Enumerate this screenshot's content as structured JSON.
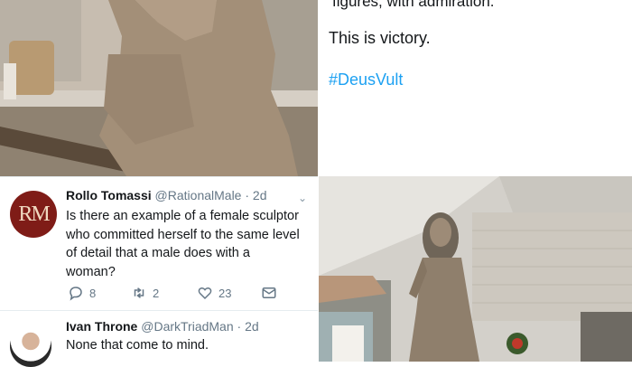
{
  "right_text": {
    "cut_line": "figures, with admiration.",
    "victory": "This is victory.",
    "hashtag": "#DeusVult"
  },
  "tweet1": {
    "avatar_text": "RM",
    "name": "Rollo Tomassi",
    "handle": "@RationalMale",
    "time": "· 2d",
    "text_lines": [
      "Is there an example of a female sculptor",
      "who committed herself to the same level",
      "of detail that a male does with a",
      "woman?"
    ],
    "reply_count": "8",
    "retweet_count": "2",
    "like_count": "23"
  },
  "tweet2": {
    "name": "Ivan Throne",
    "handle": "@DarkTriadMan",
    "time": "· 2d",
    "text": "None that come to mind."
  },
  "colors": {
    "link": "#1da1f2",
    "muted": "#657786",
    "divider": "#e6ecf0"
  }
}
